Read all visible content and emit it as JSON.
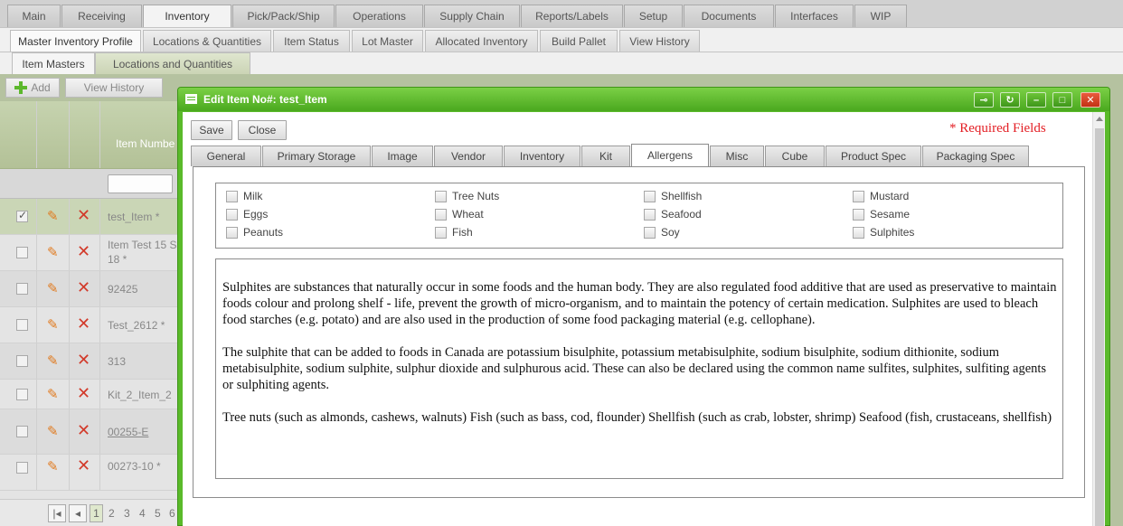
{
  "nav": {
    "main_tabs": [
      "Main",
      "Receiving",
      "Inventory",
      "Pick/Pack/Ship",
      "Operations",
      "Supply Chain",
      "Reports/Labels",
      "Setup",
      "Documents",
      "Interfaces",
      "WIP"
    ],
    "active_main": "Inventory",
    "sub_tabs": [
      "Master Inventory Profile",
      "Locations & Quantities",
      "Item Status",
      "Lot Master",
      "Allocated Inventory",
      "Build Pallet",
      "View History"
    ],
    "active_sub": "Master Inventory Profile",
    "third_tabs": [
      "Item Masters",
      "Locations and Quantities"
    ],
    "active_third": "Item Masters"
  },
  "toolbar": {
    "add_label": "Add",
    "view_history_label": "View History"
  },
  "grid": {
    "column_header": "Item Numbe",
    "rows": [
      {
        "item": "test_Item *",
        "checked": true
      },
      {
        "item": "Item Test 15 S",
        "item2": "18 *",
        "checked": false
      },
      {
        "item": "92425",
        "checked": false
      },
      {
        "item": "Test_2612 *",
        "checked": false
      },
      {
        "item": "313",
        "checked": false
      },
      {
        "item": "Kit_2_Item_2",
        "checked": false
      },
      {
        "item": "00255-E",
        "checked": false,
        "link": true
      },
      {
        "item": "00273-10 *",
        "checked": false
      }
    ],
    "pager": {
      "current": "1",
      "pages": [
        "2",
        "3",
        "4",
        "5",
        "6"
      ]
    }
  },
  "modal": {
    "title": "Edit Item No#: test_Item",
    "save_label": "Save",
    "close_label": "Close",
    "required_text": "* Required Fields",
    "tabs": [
      "General",
      "Primary Storage",
      "Image",
      "Vendor",
      "Inventory",
      "Kit",
      "Allergens",
      "Misc",
      "Cube",
      "Product Spec",
      "Packaging Spec"
    ],
    "active_tab": "Allergens",
    "allergens": [
      "Milk",
      "Eggs",
      "Peanuts",
      "Tree Nuts",
      "Wheat",
      "Fish",
      "Shellfish",
      "Seafood",
      "Soy",
      "Mustard",
      "Sesame",
      "Sulphites"
    ],
    "description": [
      "Sulphites are substances that naturally occur in some foods and the human body. They are also regulated food additive that are used as preservative to maintain foods colour and prolong shelf - life, prevent the growth of micro-organism, and to maintain the potency of certain medication. Sulphites are used to bleach food starches (e.g. potato) and are also used in the production of some food packaging material (e.g. cellophane).",
      "The sulphite that can be added to foods in Canada are potassium bisulphite, potassium metabisulphite, sodium bisulphite, sodium dithionite, sodium metabisulphite, sodium sulphite, sulphur dioxide and sulphurous acid. These can also be declared using the common name sulfites, sulphites, sulfiting agents or sulphiting agents.",
      "Tree nuts (such as almonds, cashews, walnuts) Fish (such as bass, cod, flounder) Shellfish (such as crab, lobster, shrimp) Seafood (fish, crustaceans, shellfish)"
    ]
  },
  "colors": {
    "accent_green": "#5aba2a",
    "required_red": "#e31e24",
    "delete_red": "#d23a2a",
    "edit_orange": "#e07a1f"
  }
}
